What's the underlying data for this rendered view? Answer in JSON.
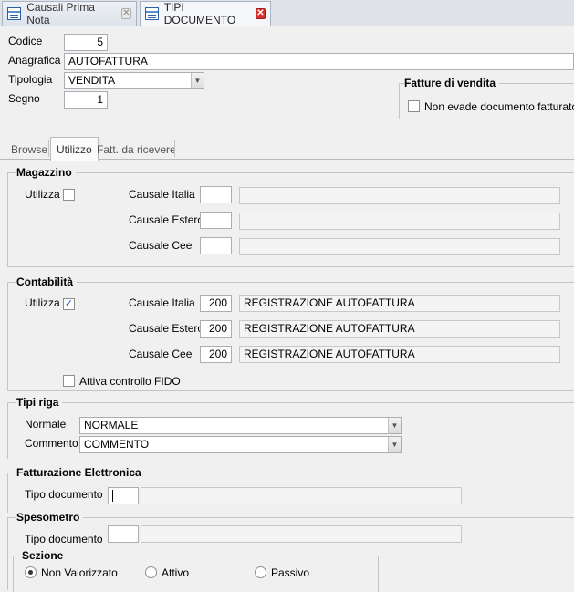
{
  "doc_tabs": [
    {
      "label": "Causali Prima Nota",
      "active": false
    },
    {
      "label": "TIPI DOCUMENTO",
      "active": true
    }
  ],
  "header": {
    "codice_label": "Codice",
    "codice_value": "5",
    "anagrafica_label": "Anagrafica",
    "anagrafica_value": "AUTOFATTURA",
    "tipologia_label": "Tipologia",
    "tipologia_value": "VENDITA",
    "segno_label": "Segno",
    "segno_value": "1"
  },
  "fatture_vendita": {
    "title": "Fatture di vendita",
    "checkbox_label": "Non evade documento fatturato",
    "checked": false
  },
  "inner_tabs": [
    {
      "label": "Browse",
      "active": false
    },
    {
      "label": "Utilizzo",
      "active": true
    },
    {
      "label": "Fatt. da ricevere",
      "active": false
    }
  ],
  "magazzino": {
    "title": "Magazzino",
    "utilizza_label": "Utilizza",
    "checked": false,
    "rows": [
      {
        "label": "Causale Italia",
        "code": "",
        "desc": ""
      },
      {
        "label": "Causale Estero",
        "code": "",
        "desc": ""
      },
      {
        "label": "Causale Cee",
        "code": "",
        "desc": ""
      }
    ]
  },
  "contabilita": {
    "title": "Contabilità",
    "utilizza_label": "Utilizza",
    "checked": true,
    "rows": [
      {
        "label": "Causale Italia",
        "code": "200",
        "desc": "REGISTRAZIONE AUTOFATTURA"
      },
      {
        "label": "Causale Estero",
        "code": "200",
        "desc": "REGISTRAZIONE AUTOFATTURA"
      },
      {
        "label": "Causale Cee",
        "code": "200",
        "desc": "REGISTRAZIONE AUTOFATTURA"
      }
    ],
    "fido_label": "Attiva controllo FIDO",
    "fido_checked": false
  },
  "tipi_riga": {
    "title": "Tipi riga",
    "normale_label": "Normale",
    "normale_value": "NORMALE",
    "commento_label": "Commento",
    "commento_value": "COMMENTO"
  },
  "fatturazione_elettronica": {
    "title": "Fatturazione Elettronica",
    "tipo_label": "Tipo documento",
    "code": "",
    "desc": ""
  },
  "spesometro": {
    "title": "Spesometro",
    "tipo_label": "Tipo documento",
    "code": "",
    "desc": ""
  },
  "sezione": {
    "title": "Sezione",
    "options": [
      {
        "label": "Non Valorizzato",
        "selected": true
      },
      {
        "label": "Attivo",
        "selected": false
      },
      {
        "label": "Passivo",
        "selected": false
      }
    ]
  },
  "colors": {
    "accent": "#1d5bbf",
    "close_red": "#d9302c"
  }
}
